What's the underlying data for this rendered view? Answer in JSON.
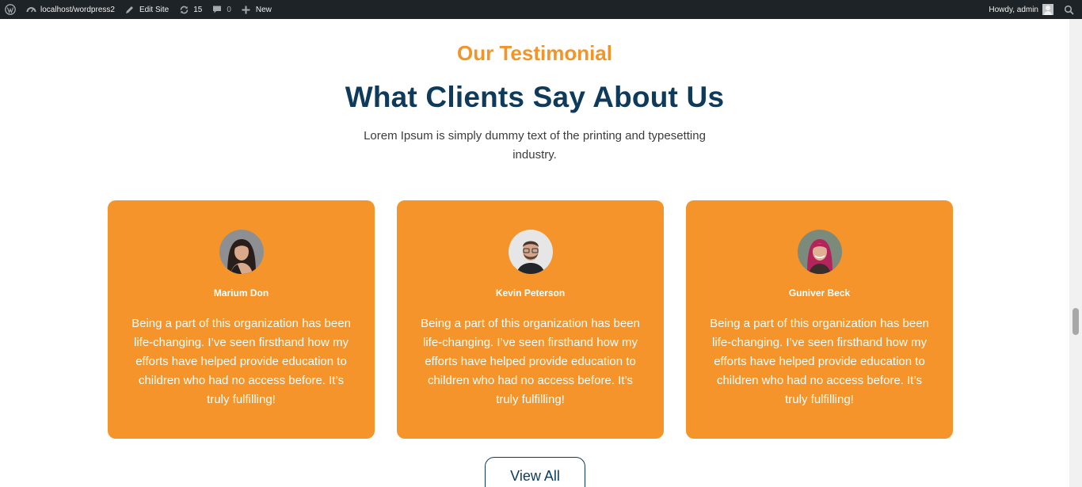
{
  "adminbar": {
    "site_url": "localhost/wordpress2",
    "edit_site": "Edit Site",
    "updates_count": "15",
    "comments_count": "0",
    "new_label": "New",
    "howdy": "Howdy, admin"
  },
  "section": {
    "eyebrow": "Our Testimonial",
    "heading": "What Clients Say About Us",
    "subtext": "Lorem Ipsum is simply dummy text of the printing and typesetting industry."
  },
  "testimonials": [
    {
      "name": "Marium Don",
      "quote": "Being a part of this organization has been life-changing. I’ve seen firsthand how my efforts have helped provide education to children who had no access before. It’s truly fulfilling!"
    },
    {
      "name": "Kevin Peterson",
      "quote": "Being a part of this organization has been life-changing. I’ve seen firsthand how my efforts have helped provide education to children who had no access before. It’s truly fulfilling!"
    },
    {
      "name": "Guniver Beck",
      "quote": "Being a part of this organization has been life-changing. I’ve seen firsthand how my efforts have helped provide education to children who had no access before. It’s truly fulfilling!"
    }
  ],
  "view_all_label": "View All",
  "colors": {
    "accent": "#f4942b",
    "heading": "#0e3a5c",
    "adminbar": "#1d2327"
  },
  "icons": [
    "wordpress-icon",
    "dashboard-icon",
    "edit-icon",
    "updates-icon",
    "comments-icon",
    "plus-icon",
    "avatar-icon",
    "search-icon"
  ]
}
